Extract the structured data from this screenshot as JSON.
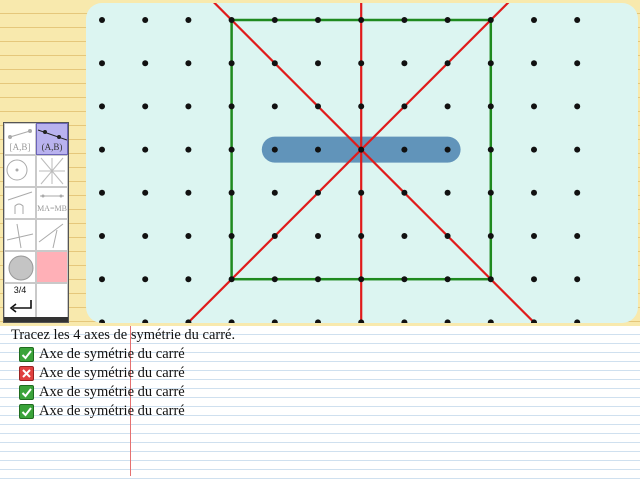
{
  "board": {
    "grid_cols": 12,
    "grid_rows": 8,
    "colors": {
      "background": "#dcf5f1",
      "dot": "#111111",
      "square": "#1f8a1f",
      "axis": "#e01b1b",
      "segment_highlight": "#5b8fb8"
    },
    "square": {
      "from": [
        3,
        0
      ],
      "to": [
        9,
        6
      ]
    },
    "axes": [
      {
        "from": [
          1,
          8
        ],
        "to": [
          11,
          -2
        ]
      },
      {
        "from": [
          6,
          -1
        ],
        "to": [
          6,
          7
        ]
      },
      {
        "from": [
          2,
          -1
        ],
        "to": [
          10,
          7
        ]
      }
    ],
    "highlight": {
      "from": [
        4,
        3
      ],
      "to": [
        8,
        3
      ]
    }
  },
  "palette": {
    "tools": [
      {
        "name": "segment-tool",
        "label": "[A,B]",
        "icon": "segment-icon",
        "selected": false
      },
      {
        "name": "line-tool",
        "label": "(A,B)",
        "icon": "line-icon",
        "selected": true
      },
      {
        "name": "circle-tool",
        "label": "",
        "icon": "circle-icon",
        "selected": false
      },
      {
        "name": "grid-tool",
        "label": "",
        "icon": "grid-icon",
        "selected": false
      },
      {
        "name": "angle-tool",
        "label": "",
        "icon": "angle-icon",
        "selected": false
      },
      {
        "name": "midpoint-tool",
        "label": "MA=MB",
        "icon": "mediator-icon",
        "selected": false
      },
      {
        "name": "perpendicular-tool",
        "label": "",
        "icon": "perpendicular-icon",
        "selected": false
      },
      {
        "name": "parallel-tool",
        "label": "",
        "icon": "parallel-icon",
        "selected": false
      },
      {
        "name": "gray-color",
        "label": "",
        "icon": "gray-disc-icon",
        "selected": false
      },
      {
        "name": "pink-color",
        "label": "",
        "icon": "pink-swatch-icon",
        "selected": false
      }
    ],
    "counter": "3/4",
    "undo_icon": "undo-arrow-icon"
  },
  "instructions": {
    "prompt": "Tracez les 4 axes de symétrie du carré.",
    "answers": [
      {
        "label": "Axe de symétrie du carré",
        "status": "correct",
        "icon": "check-icon"
      },
      {
        "label": "Axe de symétrie du carré",
        "status": "wrong",
        "icon": "cross-icon"
      },
      {
        "label": "Axe de symétrie du carré",
        "status": "correct",
        "icon": "check-icon"
      },
      {
        "label": "Axe de symétrie du carré",
        "status": "correct",
        "icon": "check-icon"
      }
    ]
  }
}
